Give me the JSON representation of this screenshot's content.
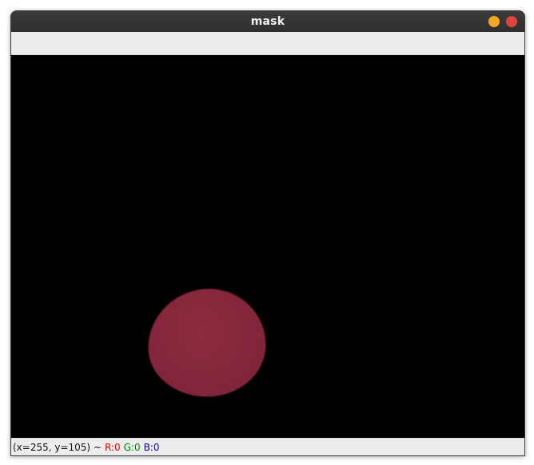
{
  "window": {
    "title": "mask",
    "buttons": {
      "minimize_color": "#f5a623",
      "close_color": "#e0443e"
    }
  },
  "canvas": {
    "background": "#000000",
    "blob_color": "#84263b"
  },
  "statusbar": {
    "coords": "(x=255, y=105) ~",
    "r_label": "R:0",
    "g_label": "G:0",
    "b_label": "B:0",
    "r_color": "#e00000",
    "g_color": "#008a00",
    "b_color": "#0000e0"
  }
}
